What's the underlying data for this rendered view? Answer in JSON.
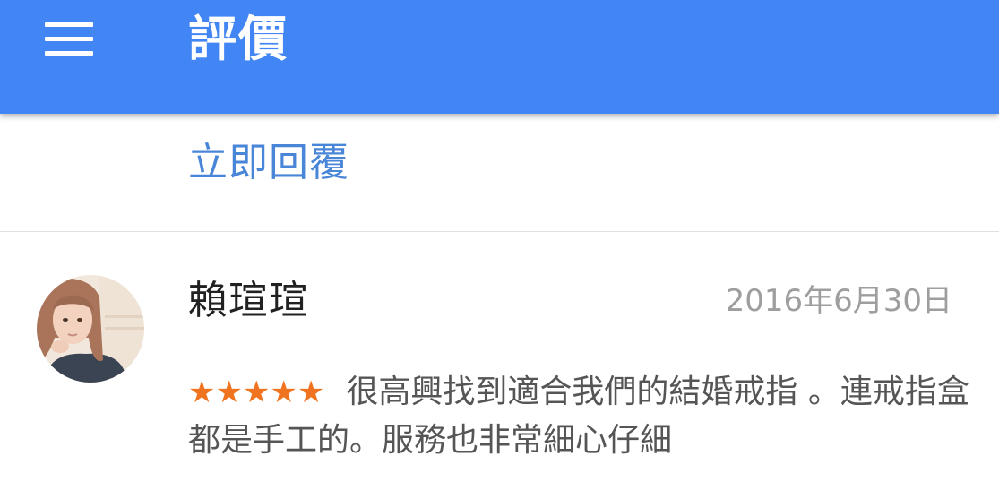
{
  "appbar": {
    "title": "評價",
    "color": "#4285f4",
    "menu_icon": "menu-icon"
  },
  "reply": {
    "label": "立即回覆",
    "color": "#4a86d8"
  },
  "review": {
    "reviewer_name": "賴瑄瑄",
    "date": "2016年6月30日",
    "rating": 5,
    "rating_stars": "★★★★★",
    "text": "很高興找到適合我們的結婚戒指 。連戒指盒都是手工的。服務也非常細心仔細",
    "star_color": "#f0741f",
    "avatar_icon": "reviewer-photo"
  }
}
